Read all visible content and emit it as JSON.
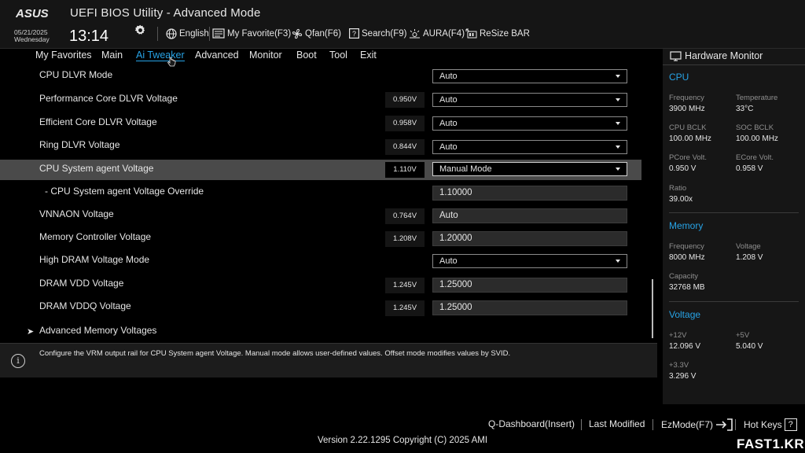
{
  "header": {
    "brand": "ASUS",
    "title": "UEFI BIOS Utility - Advanced Mode",
    "date": "05/21/2025",
    "weekday": "Wednesday",
    "time": "13:14",
    "toolbar": [
      {
        "label": "English",
        "icon": "globe-icon"
      },
      {
        "label": "My Favorite(F3)",
        "icon": "favorite-icon"
      },
      {
        "label": "Qfan(F6)",
        "icon": "fan-icon"
      },
      {
        "label": "Search(F9)",
        "icon": "search-icon"
      },
      {
        "label": "AURA(F4)",
        "icon": "aura-icon"
      },
      {
        "label": "ReSize BAR",
        "icon": "resize-bar-icon"
      }
    ]
  },
  "menu": {
    "items": [
      "My Favorites",
      "Main",
      "Ai Tweaker",
      "Advanced",
      "Monitor",
      "Boot",
      "Tool",
      "Exit"
    ],
    "active": "Ai Tweaker"
  },
  "settings": [
    {
      "label": "CPU DLVR Mode",
      "voltage": "",
      "control": "dropdown",
      "value": "Auto"
    },
    {
      "label": "Performance Core DLVR Voltage",
      "voltage": "0.950V",
      "control": "dropdown",
      "value": "Auto"
    },
    {
      "label": "Efficient Core DLVR Voltage",
      "voltage": "0.958V",
      "control": "dropdown",
      "value": "Auto"
    },
    {
      "label": "Ring DLVR Voltage",
      "voltage": "0.844V",
      "control": "dropdown",
      "value": "Auto"
    },
    {
      "label": "CPU System agent Voltage",
      "voltage": "1.110V",
      "control": "dropdown",
      "value": "Manual Mode",
      "selected": true
    },
    {
      "label": "- CPU System agent Voltage Override",
      "voltage": "",
      "control": "field",
      "value": "1.10000"
    },
    {
      "label": "VNNAON Voltage",
      "voltage": "0.764V",
      "control": "field",
      "value": "Auto"
    },
    {
      "label": "Memory Controller Voltage",
      "voltage": "1.208V",
      "control": "field",
      "value": "1.20000"
    },
    {
      "label": "High DRAM Voltage Mode",
      "voltage": "",
      "control": "dropdown",
      "value": "Auto"
    },
    {
      "label": "DRAM VDD Voltage",
      "voltage": "1.245V",
      "control": "field",
      "value": "1.25000"
    },
    {
      "label": "DRAM VDDQ Voltage",
      "voltage": "1.245V",
      "control": "field",
      "value": "1.25000"
    },
    {
      "label": "Advanced Memory Voltages",
      "voltage": "",
      "control": "submenu",
      "value": ""
    }
  ],
  "help": {
    "text": "Configure the VRM output rail for CPU System agent Voltage. Manual mode allows user-defined values. Offset mode modifies values by SVID."
  },
  "hardware_monitor": {
    "title": "Hardware Monitor",
    "cpu": {
      "section": "CPU",
      "frequency_label": "Frequency",
      "frequency": "3900 MHz",
      "temperature_label": "Temperature",
      "temperature": "33°C",
      "bclk_label": "CPU BCLK",
      "bclk": "100.00 MHz",
      "soc_bclk_label": "SOC BCLK",
      "soc_bclk": "100.00 MHz",
      "pcore_label": "PCore Volt.",
      "pcore": "0.950 V",
      "ecore_label": "ECore Volt.",
      "ecore": "0.958 V",
      "ratio_label": "Ratio",
      "ratio": "39.00x"
    },
    "memory": {
      "section": "Memory",
      "frequency_label": "Frequency",
      "frequency": "8000 MHz",
      "voltage_label": "Voltage",
      "voltage": "1.208 V",
      "capacity_label": "Capacity",
      "capacity": "32768 MB"
    },
    "voltage": {
      "section": "Voltage",
      "v12_label": "+12V",
      "v12": "12.096 V",
      "v5_label": "+5V",
      "v5": "5.040 V",
      "v33_label": "+3.3V",
      "v33": "3.296 V"
    }
  },
  "footer": {
    "qdashboard": "Q-Dashboard(Insert)",
    "last_modified": "Last Modified",
    "ezmode": "EzMode(F7)",
    "hotkeys": "Hot Keys",
    "hotkeys_icon": "?",
    "version": "Version 2.22.1295 Copyright (C) 2025 AMI",
    "watermark": "FAST1.KR"
  }
}
